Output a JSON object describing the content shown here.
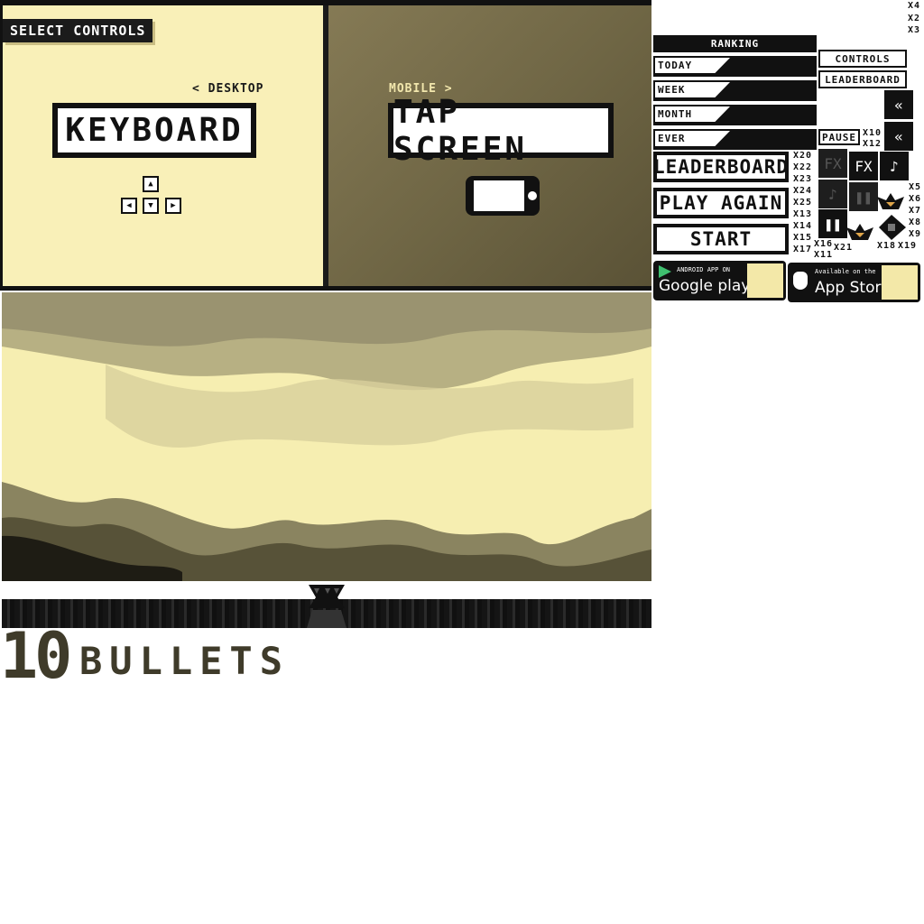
{
  "select_controls": {
    "title": "SELECT CONTROLS",
    "desktop_link": "< DESKTOP",
    "mobile_link": "MOBILE >",
    "keyboard_label": "KEYBOARD",
    "tap_label": "TAP SCREEN",
    "arrow_keys": [
      "▲",
      "◀",
      "▼",
      "▶"
    ]
  },
  "logo": {
    "number": "10",
    "word": "BULLETS"
  },
  "ranking": {
    "title": "RANKING",
    "periods": [
      "TODAY",
      "WEEK",
      "MONTH",
      "EVER"
    ]
  },
  "buttons": {
    "leaderboard_large": "LEADERBOARD",
    "play_again": "PLAY AGAIN",
    "start": "START",
    "controls": "CONTROLS",
    "leaderboard_small": "LEADERBOARD",
    "pause": "PAUSE"
  },
  "icons": {
    "back": "«",
    "fx": "FX",
    "music": "♪",
    "pause": "❚❚"
  },
  "multipliers": {
    "top": [
      "X4",
      "X2",
      "X3"
    ],
    "mid_a": [
      "X20",
      "X22",
      "X23",
      "X24",
      "X25",
      "X13",
      "X14",
      "X15",
      "X17"
    ],
    "mid_b": [
      "X16",
      "X11",
      "X21"
    ],
    "pause_side": [
      "X10",
      "X12"
    ],
    "right_col": [
      "X5",
      "X6",
      "X7",
      "X8",
      "X9"
    ],
    "bottom": [
      "X18",
      "X19"
    ]
  },
  "stores": {
    "google_small": "ANDROID APP ON",
    "google_big": "Google play",
    "apple_small": "Available on the",
    "apple_big": "App Store"
  }
}
